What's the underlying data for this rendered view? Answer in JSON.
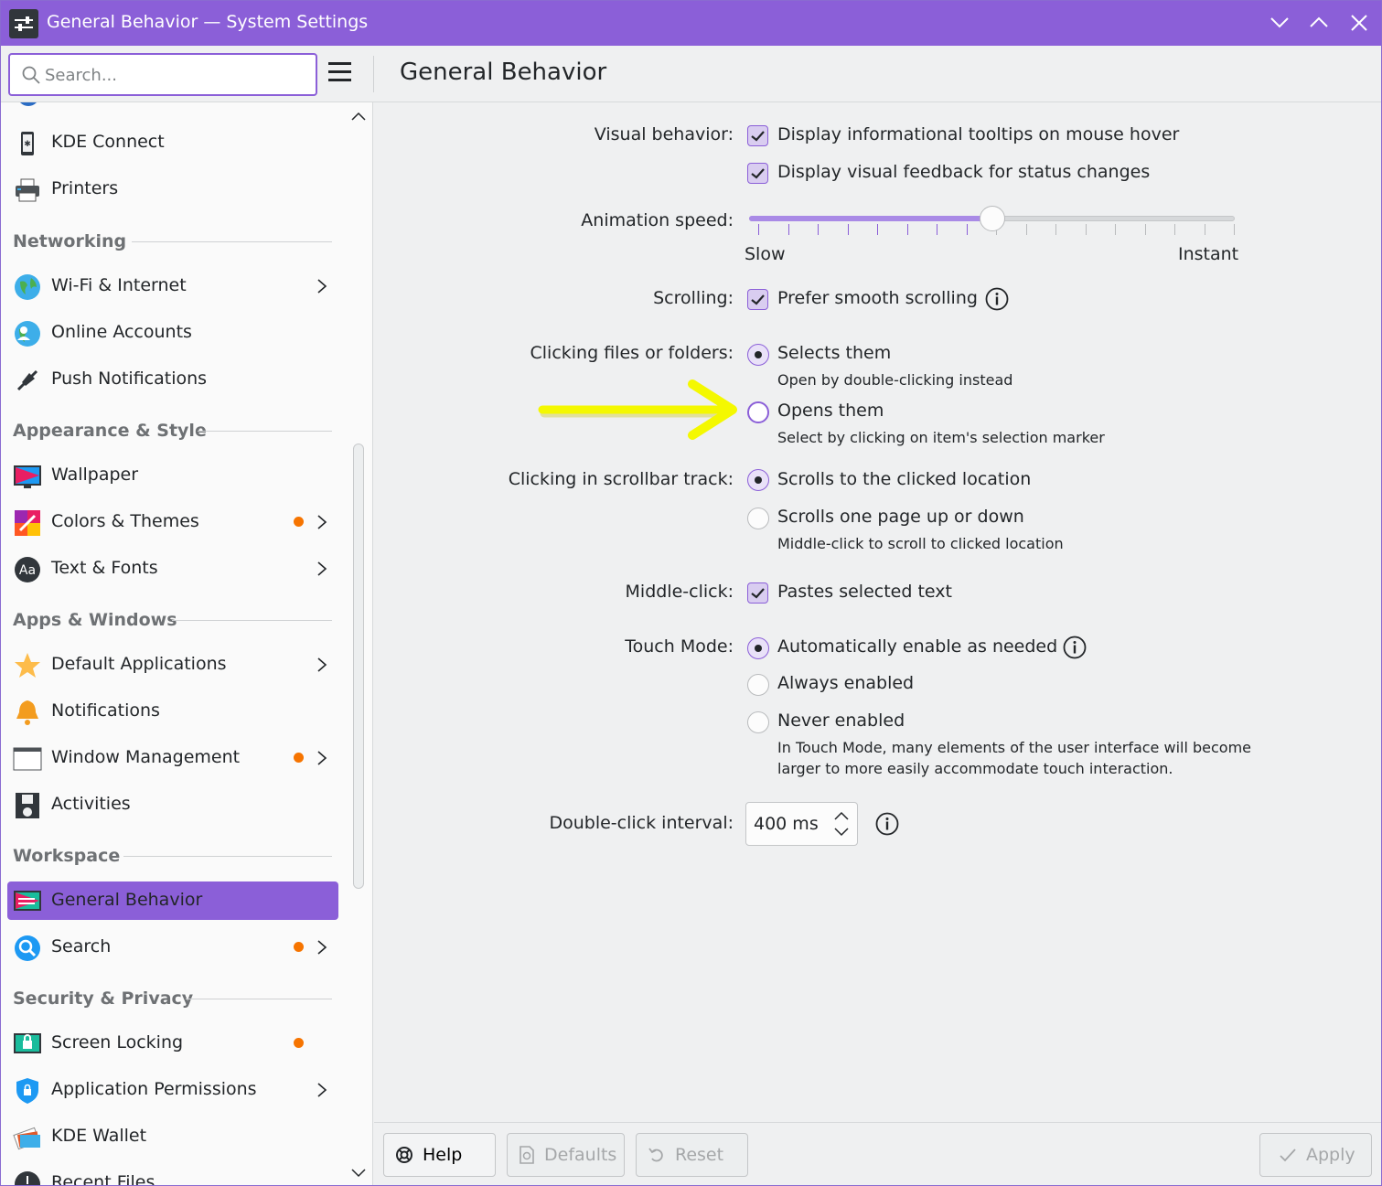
{
  "window": {
    "title": "General Behavior — System Settings",
    "accent": "#8b5fd8"
  },
  "search": {
    "placeholder": "Search..."
  },
  "page": {
    "title": "General Behavior"
  },
  "sidebar": {
    "items_top": [
      {
        "label": "KDE Connect",
        "icon": "kde-connect-icon"
      },
      {
        "label": "Printers",
        "icon": "printer-icon"
      }
    ],
    "categories": {
      "networking": "Networking",
      "appearance": "Appearance & Style",
      "apps": "Apps & Windows",
      "workspace": "Workspace",
      "security": "Security & Privacy"
    },
    "networking": [
      {
        "label": "Wi-Fi & Internet",
        "icon": "globe-icon",
        "chevron": true
      },
      {
        "label": "Online Accounts",
        "icon": "online-accounts-icon"
      },
      {
        "label": "Push Notifications",
        "icon": "push-notifications-icon"
      }
    ],
    "appearance": [
      {
        "label": "Wallpaper",
        "icon": "wallpaper-icon"
      },
      {
        "label": "Colors & Themes",
        "icon": "colors-icon",
        "dot": true,
        "chevron": true
      },
      {
        "label": "Text & Fonts",
        "icon": "fonts-icon",
        "chevron": true
      }
    ],
    "apps": [
      {
        "label": "Default Applications",
        "icon": "star-icon",
        "chevron": true
      },
      {
        "label": "Notifications",
        "icon": "bell-icon"
      },
      {
        "label": "Window Management",
        "icon": "window-icon",
        "dot": true,
        "chevron": true
      },
      {
        "label": "Activities",
        "icon": "activities-icon"
      }
    ],
    "workspace": [
      {
        "label": "General Behavior",
        "icon": "general-behavior-icon",
        "selected": true
      },
      {
        "label": "Search",
        "icon": "search-icon",
        "dot": true,
        "chevron": true
      }
    ],
    "security": [
      {
        "label": "Screen Locking",
        "icon": "screen-lock-icon",
        "dot": true
      },
      {
        "label": "Application Permissions",
        "icon": "shield-icon",
        "chevron": true
      },
      {
        "label": "KDE Wallet",
        "icon": "wallet-icon"
      },
      {
        "label": "Recent Files",
        "icon": "recent-files-icon"
      }
    ]
  },
  "settings": {
    "visual_behavior": {
      "label": "Visual behavior:",
      "opt1": "Display informational tooltips on mouse hover",
      "opt2": "Display visual feedback for status changes",
      "opt1_checked": true,
      "opt2_checked": true
    },
    "animation": {
      "label": "Animation speed:",
      "min_label": "Slow",
      "max_label": "Instant",
      "value_fraction": 0.5
    },
    "scrolling": {
      "label": "Scrolling:",
      "opt": "Prefer smooth scrolling",
      "checked": true
    },
    "clicking": {
      "label": "Clicking files or folders:",
      "opt1": "Selects them",
      "opt1_sub": "Open by double-clicking instead",
      "opt2": "Opens them",
      "opt2_sub": "Select by clicking on item's selection marker",
      "selected": "opt1"
    },
    "scrollbar": {
      "label": "Clicking in scrollbar track:",
      "opt1": "Scrolls to the clicked location",
      "opt2": "Scrolls one page up or down",
      "opt2_sub": "Middle-click to scroll to clicked location",
      "selected": "opt1"
    },
    "middle_click": {
      "label": "Middle-click:",
      "opt": "Pastes selected text",
      "checked": true
    },
    "touch_mode": {
      "label": "Touch Mode:",
      "opt1": "Automatically enable as needed",
      "opt2": "Always enabled",
      "opt3": "Never enabled",
      "note_line1": "In Touch Mode, many elements of the user interface will become",
      "note_line2": "larger to more easily accommodate touch interaction.",
      "selected": "opt1"
    },
    "double_click": {
      "label": "Double-click interval:",
      "value": "400 ms"
    }
  },
  "footer": {
    "help": "Help",
    "defaults": "Defaults",
    "reset": "Reset",
    "apply": "Apply"
  }
}
